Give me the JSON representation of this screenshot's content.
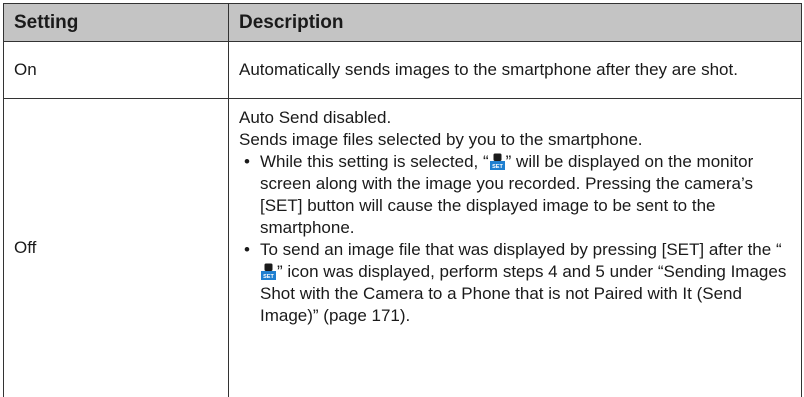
{
  "header": {
    "setting": "Setting",
    "description": "Description"
  },
  "rows": [
    {
      "setting": "On",
      "description": "Automatically sends images to the smartphone after they are shot."
    },
    {
      "setting": "Off",
      "lines": [
        "Auto Send disabled.",
        "Sends image files selected by you to the smartphone."
      ],
      "bullets": [
        {
          "before": "While this setting is selected, “",
          "after": "” will be displayed on the monitor screen along with the image you recorded. Pressing the camera’s [SET] button will cause the displayed image to be sent to the smartphone."
        },
        {
          "before": "To send an image file that was displayed by pressing [SET] after the “",
          "after": "” icon was displayed, perform steps 4 and 5 under “Sending Images Shot with the Camera to a Phone that is not Paired with It (Send Image)” (page 171)."
        }
      ]
    }
  ],
  "icons": {
    "send_icon": "phone-set-icon",
    "icon_top_color": "#1a1a1a",
    "icon_bottom_color": "#1e7fd0",
    "icon_label": "SET"
  }
}
